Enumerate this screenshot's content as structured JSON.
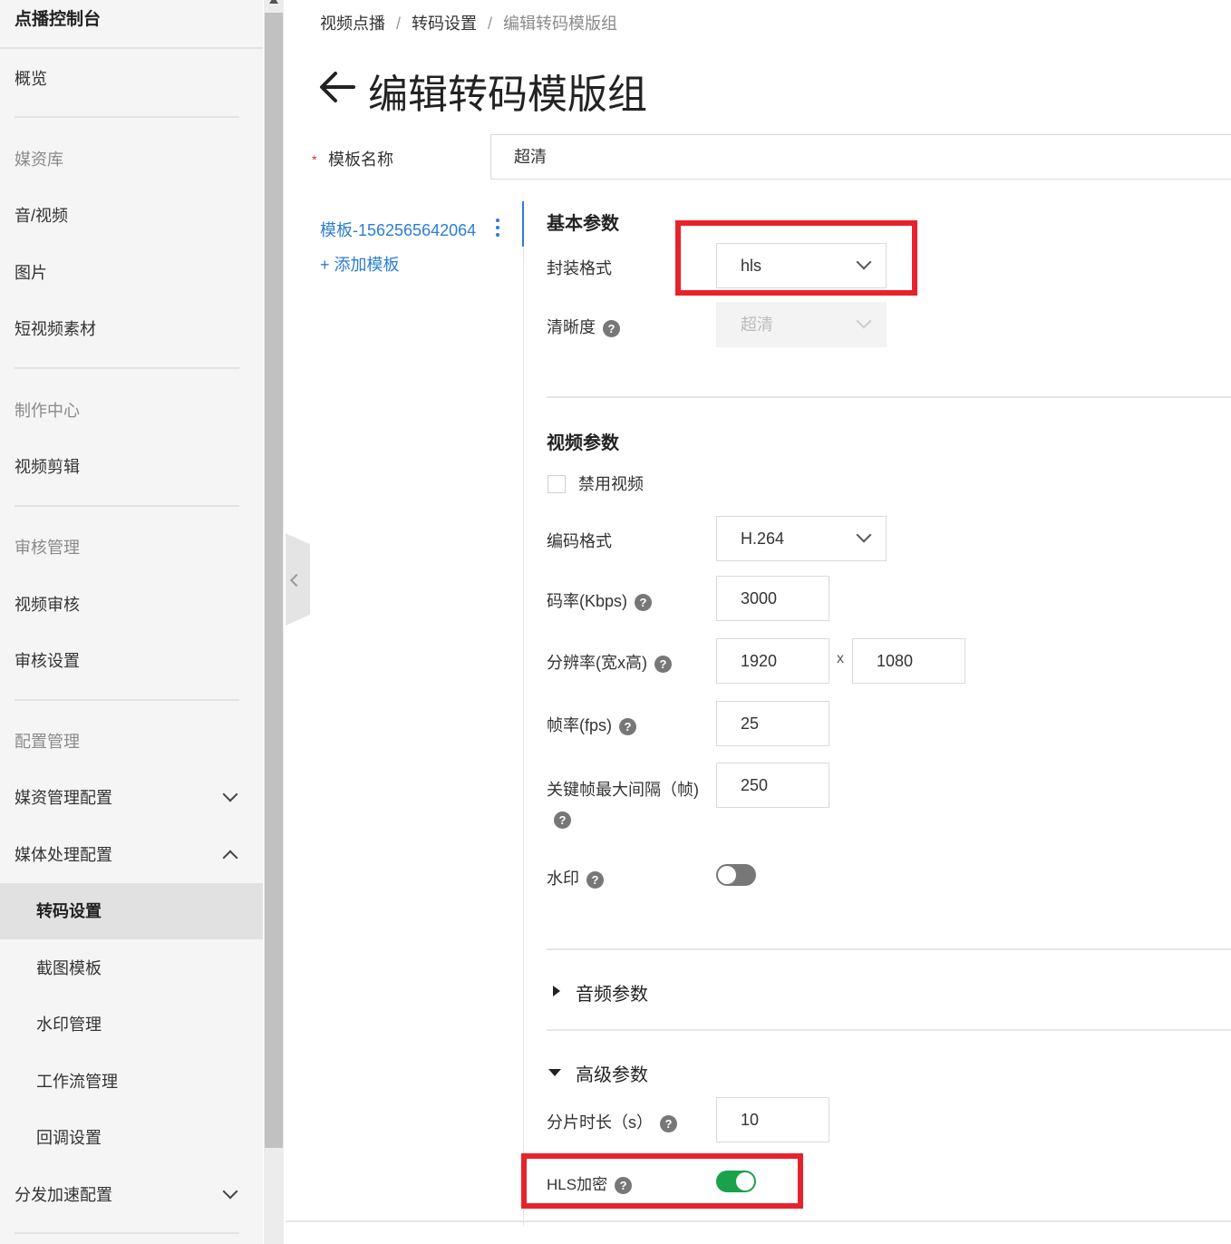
{
  "sidebar": {
    "title": "点播控制台",
    "items": [
      {
        "label": "概览"
      },
      {
        "label": "媒资库"
      },
      {
        "label": "音/视频"
      },
      {
        "label": "图片"
      },
      {
        "label": "短视频素材"
      },
      {
        "label": "制作中心"
      },
      {
        "label": "视频剪辑"
      },
      {
        "label": "审核管理"
      },
      {
        "label": "视频审核"
      },
      {
        "label": "审核设置"
      },
      {
        "label": "配置管理"
      },
      {
        "label": "媒资管理配置"
      },
      {
        "label": "媒体处理配置"
      },
      {
        "label": "转码设置"
      },
      {
        "label": "截图模板"
      },
      {
        "label": "水印管理"
      },
      {
        "label": "工作流管理"
      },
      {
        "label": "回调设置"
      },
      {
        "label": "分发加速配置"
      }
    ]
  },
  "breadcrumb": [
    "视频点播",
    "转码设置",
    "编辑转码模版组"
  ],
  "breadcrumb_sep": "/",
  "page_title": "编辑转码模版组",
  "form": {
    "required_mark": "*",
    "template_name_label": "模板名称",
    "template_name_value": "超清"
  },
  "templates": {
    "active": "模板-1562565642064",
    "add": "+ 添加模板"
  },
  "basic": {
    "title": "基本参数",
    "container_label": "封装格式",
    "container_value": "hls",
    "definition_label": "清晰度",
    "definition_value": "超清"
  },
  "video": {
    "title": "视频参数",
    "disable_label": "禁用视频",
    "codec_label": "编码格式",
    "codec_value": "H.264",
    "bitrate_label": "码率(Kbps)",
    "bitrate_value": "3000",
    "resolution_label": "分辨率(宽x高)",
    "width_value": "1920",
    "times": "x",
    "height_value": "1080",
    "fps_label": "帧率(fps)",
    "fps_value": "25",
    "gop_label": "关键帧最大间隔（帧)",
    "gop_value": "250",
    "watermark_label": "水印",
    "watermark_on": false
  },
  "audio": {
    "title": "音频参数"
  },
  "advanced": {
    "title": "高级参数",
    "segment_label": "分片时长（s）",
    "segment_value": "10",
    "hls_encrypt_label": "HLS加密",
    "hls_encrypt_on": true
  },
  "help_glyph": "?",
  "colors": {
    "link": "#2b7dd6",
    "toggle_on": "#1aa14b",
    "highlight": "#e8222b"
  }
}
